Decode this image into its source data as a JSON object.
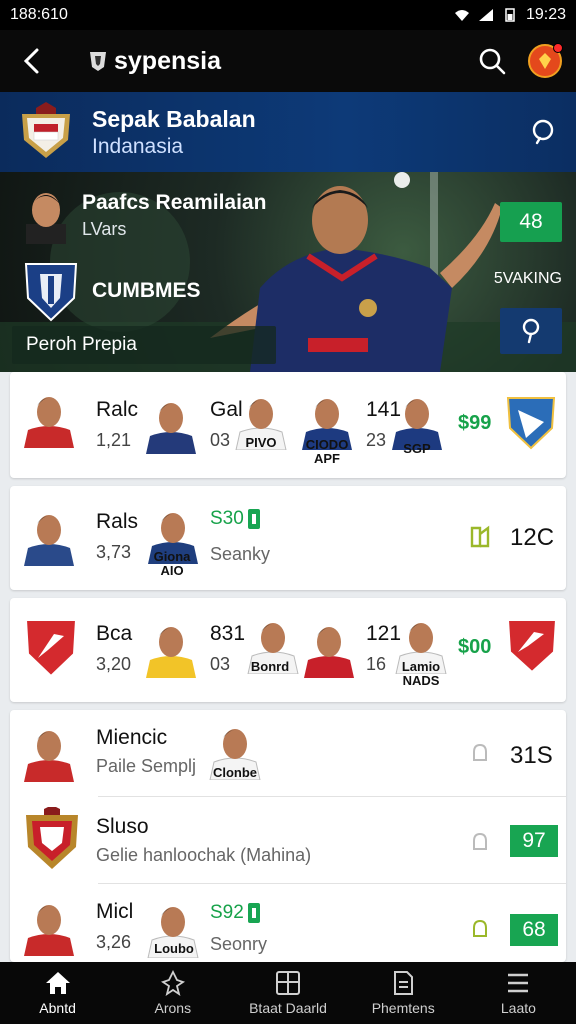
{
  "status": {
    "time_left": "188:610",
    "time_right": "19:23"
  },
  "app": {
    "brand": "sypensia"
  },
  "league": {
    "title": "Sepak Babalan",
    "subtitle": "Indanasia"
  },
  "hero": {
    "player_name": "Paafcs Reamilaian",
    "player_sub": "LVars",
    "club_name": "CUMBMES",
    "badge_value": "48",
    "ranking_label": "5VAKING",
    "label_bar": "Peroh Prepia"
  },
  "cards": [
    {
      "team": "Ralc",
      "num": "1,21",
      "c1_top": "Gal",
      "c1_bottom": "03",
      "c2_caption": "PIVO",
      "c3_top": "141",
      "c3_bottom": "23",
      "c3_caption": "CIODO APF",
      "c4_caption": "SGP",
      "green": "$99"
    },
    {
      "team": "Rals",
      "num": "3,73",
      "c1_caption": "Giona AIO",
      "green": "S30",
      "grey": "Seanky",
      "big": "12C"
    },
    {
      "team": "Bca",
      "num": "3,20",
      "c1_top": "831",
      "c1_bottom": "03",
      "c2_caption": "Bonrd",
      "c3_top": "121",
      "c3_bottom": "16",
      "c4_caption": "Lamio NADS",
      "green": "$00"
    }
  ],
  "list": [
    {
      "name": "Miencic",
      "sub": "Paile Semplj",
      "caption": "Clonbe",
      "big": "31S"
    },
    {
      "name": "Sluso",
      "sub": "Gelie hanloochak (Mahina)",
      "score": "97"
    },
    {
      "name": "Micl",
      "sub": "3,26",
      "caption": "Loubo",
      "green": "S92",
      "grey": "Seonry",
      "score": "68"
    }
  ],
  "nav": [
    {
      "label": "Abntd",
      "icon": "home-icon"
    },
    {
      "label": "Arons",
      "icon": "tree-icon"
    },
    {
      "label": "Btaat Daarld",
      "icon": "board-icon"
    },
    {
      "label": "Phemtens",
      "icon": "document-icon"
    },
    {
      "label": "Laato",
      "icon": "menu-icon"
    }
  ],
  "colors": {
    "accent_green": "#17a24a",
    "header_blue": "#0d3a78",
    "bar_black": "#0a0a0a"
  }
}
